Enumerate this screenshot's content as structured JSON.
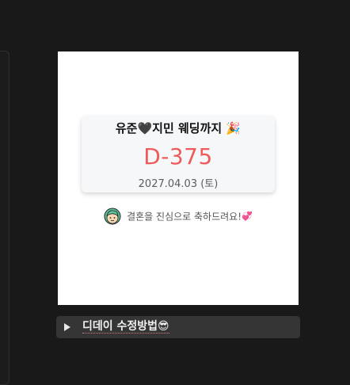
{
  "dday_widget": {
    "title": "유준🖤지민 웨딩까지",
    "title_emoji": "🎉",
    "count": "D-375",
    "date": "2027.04.03 (토)",
    "message": "결혼을 진심으로 축하드려요!",
    "message_emoji": "💞",
    "count_color": "#ef5b5b"
  },
  "toggle": {
    "label": "디데이 수정방법😎"
  }
}
